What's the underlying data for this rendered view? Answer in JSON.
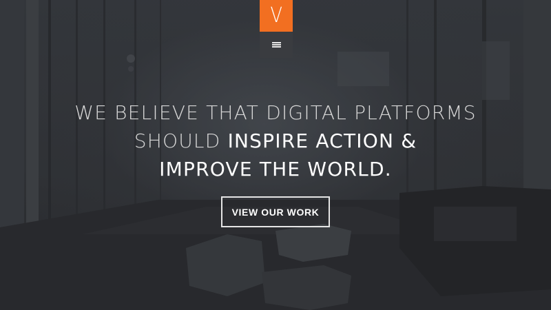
{
  "brand": {
    "logo_letter": "V",
    "accent_color": "#f26f21"
  },
  "nav": {
    "menu_icon": "hamburger-menu-icon"
  },
  "hero": {
    "line1": "WE BELIEVE THAT DIGITAL PLATFORMS",
    "line2_prefix": "SHOULD ",
    "line2_emphasis": "INSPIRE ACTION &",
    "line3": "IMPROVE THE WORLD.",
    "cta_label": "VIEW OUR WORK"
  },
  "background": {
    "description_icon": "office-hallway-photo"
  }
}
